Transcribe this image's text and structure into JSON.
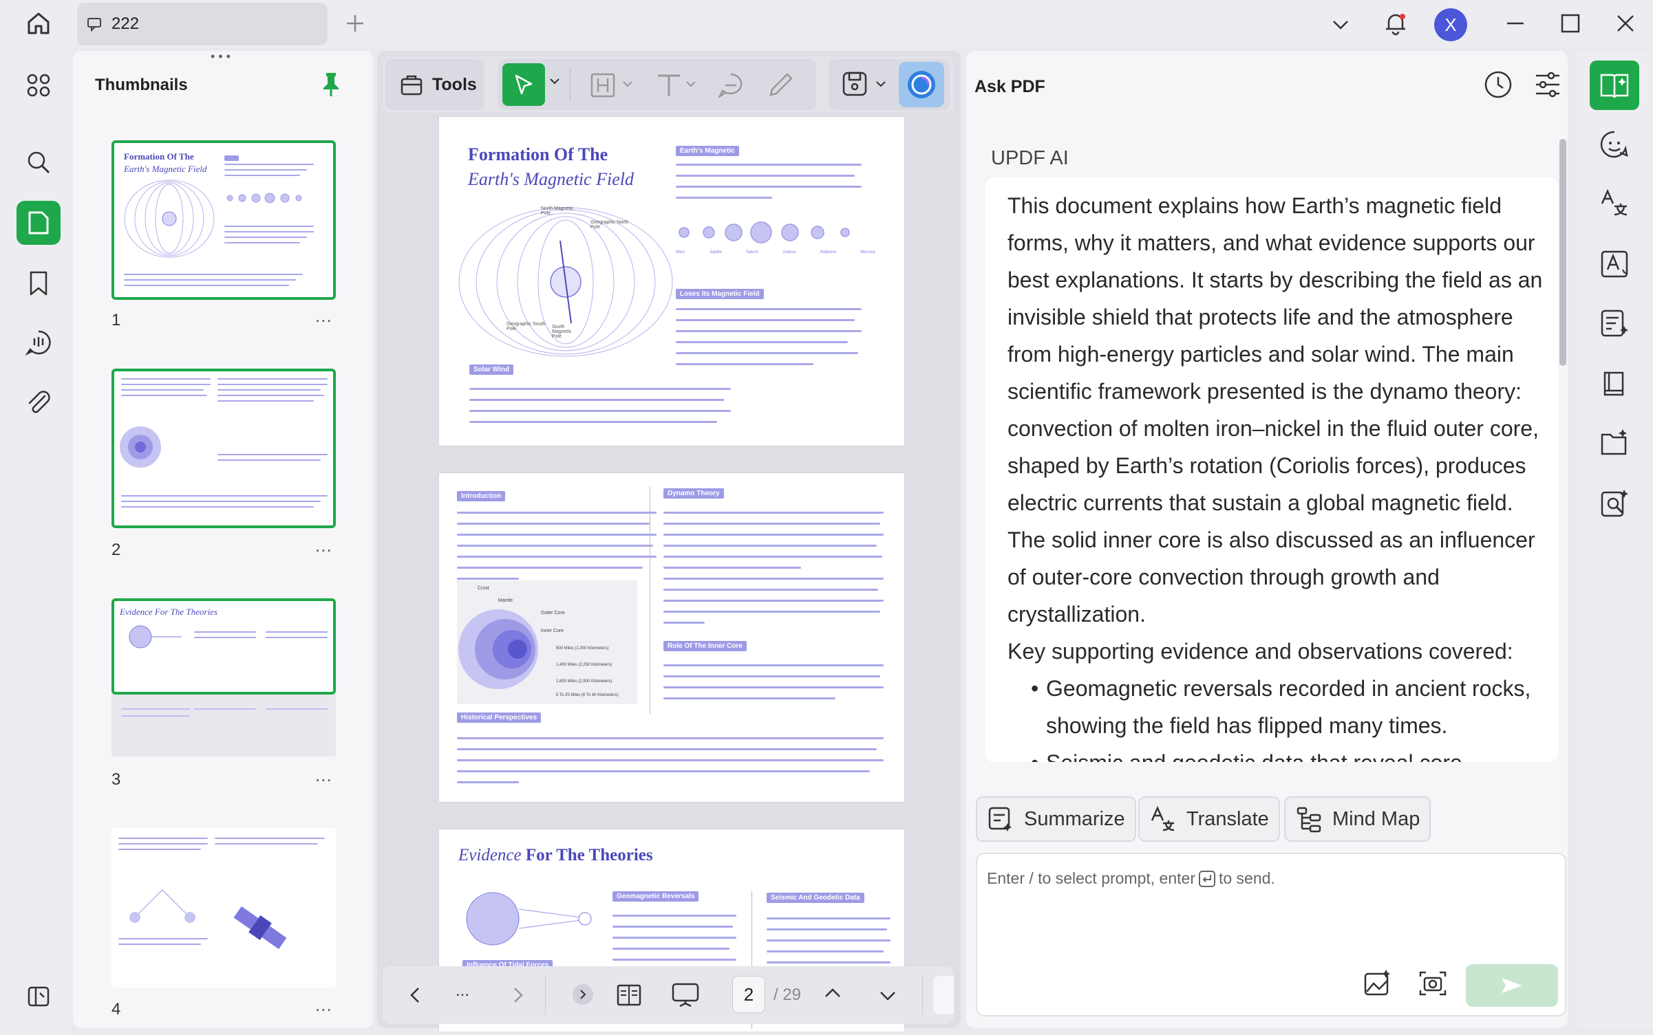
{
  "tab": {
    "title": "222"
  },
  "window": {
    "avatar_letter": "X"
  },
  "thumbnails": {
    "title": "Thumbnails",
    "pages": [
      {
        "number": "1",
        "heading": "Formation Of The",
        "subheading": "Earth's Magnetic Field"
      },
      {
        "number": "2"
      },
      {
        "number": "3",
        "heading": "Evidence For The Theories"
      },
      {
        "number": "4"
      }
    ],
    "more": "..."
  },
  "toolbar": {
    "tools_label": "Tools"
  },
  "document": {
    "page1": {
      "title_line1": "Formation Of The",
      "title_line2": "Earth's Magnetic Field",
      "tag_earth": "Earth's Magnetic",
      "tag_loses": "Loses Its Magnetic Field",
      "tag_solar": "Solar Wind",
      "label_north_geo": "North Magnetic Pole",
      "label_geo_north": "Geographic North Pole",
      "label_geo_south": "Geographic South Pole",
      "label_south_mag": "South Magnetic Pole",
      "planets": [
        "Mars",
        "Jupiter",
        "Saturn",
        "Uranus",
        "Neptune",
        "Mercury"
      ]
    },
    "page2": {
      "tag_intro": "Introduction",
      "tag_dynamo": "Dynamo Theory",
      "tag_role": "Role Of The Inner Core",
      "tag_hist": "Historical Perspectives",
      "labels": [
        "Crust",
        "Mantle",
        "Outer Core",
        "Inner Core"
      ],
      "depths": [
        "800 Miles (1,300 Kilometers)",
        "1,400 Miles (2,250 Kilometers)",
        "1,800 Miles (2,900 Kilometers)",
        "5 To 25 Miles (8 To 40 Kilometers)"
      ]
    },
    "page3": {
      "title_italic": "Evidence",
      "title_rest": "For The Theories",
      "tag_geo": "Geomagnetic Reversals",
      "tag_seismic": "Seismic And Geodetic Data",
      "tag_influence": "Influence Of Tidal Forces"
    }
  },
  "pager": {
    "current": "2",
    "total": "/ 29",
    "more": "..."
  },
  "ask": {
    "title": "Ask PDF",
    "ai_label": "UPDF AI",
    "answer_paragraph": "This document explains how Earth’s magnetic field forms, why it matters, and what evidence supports our best explanations. It starts by describing the field as an invisible shield that protects life and the atmosphere from high-energy particles and solar wind. The main scientific framework presented is the dynamo theory: convection of molten iron–nickel in the fluid outer core, shaped by Earth’s rotation (Coriolis forces), produces electric currents that sustain a global magnetic field. The solid inner core is also discussed as an influencer of outer-core convection through growth and crystallization.",
    "evidence_heading": "Key supporting evidence and observations covered:",
    "bullets": [
      "Geomagnetic reversals recorded in ancient rocks, showing the field has flipped many times.",
      "Seismic and geodetic data that reveal core"
    ],
    "chips": {
      "summarize": "Summarize",
      "translate": "Translate",
      "mindmap": "Mind Map"
    },
    "input_placeholder_pre": "Enter / to select prompt, enter",
    "input_placeholder_post": "to send."
  },
  "colors": {
    "accent_green": "#1fa84b",
    "accent_purple": "#7e7ae0",
    "avatar_bg": "#4b57d8"
  }
}
